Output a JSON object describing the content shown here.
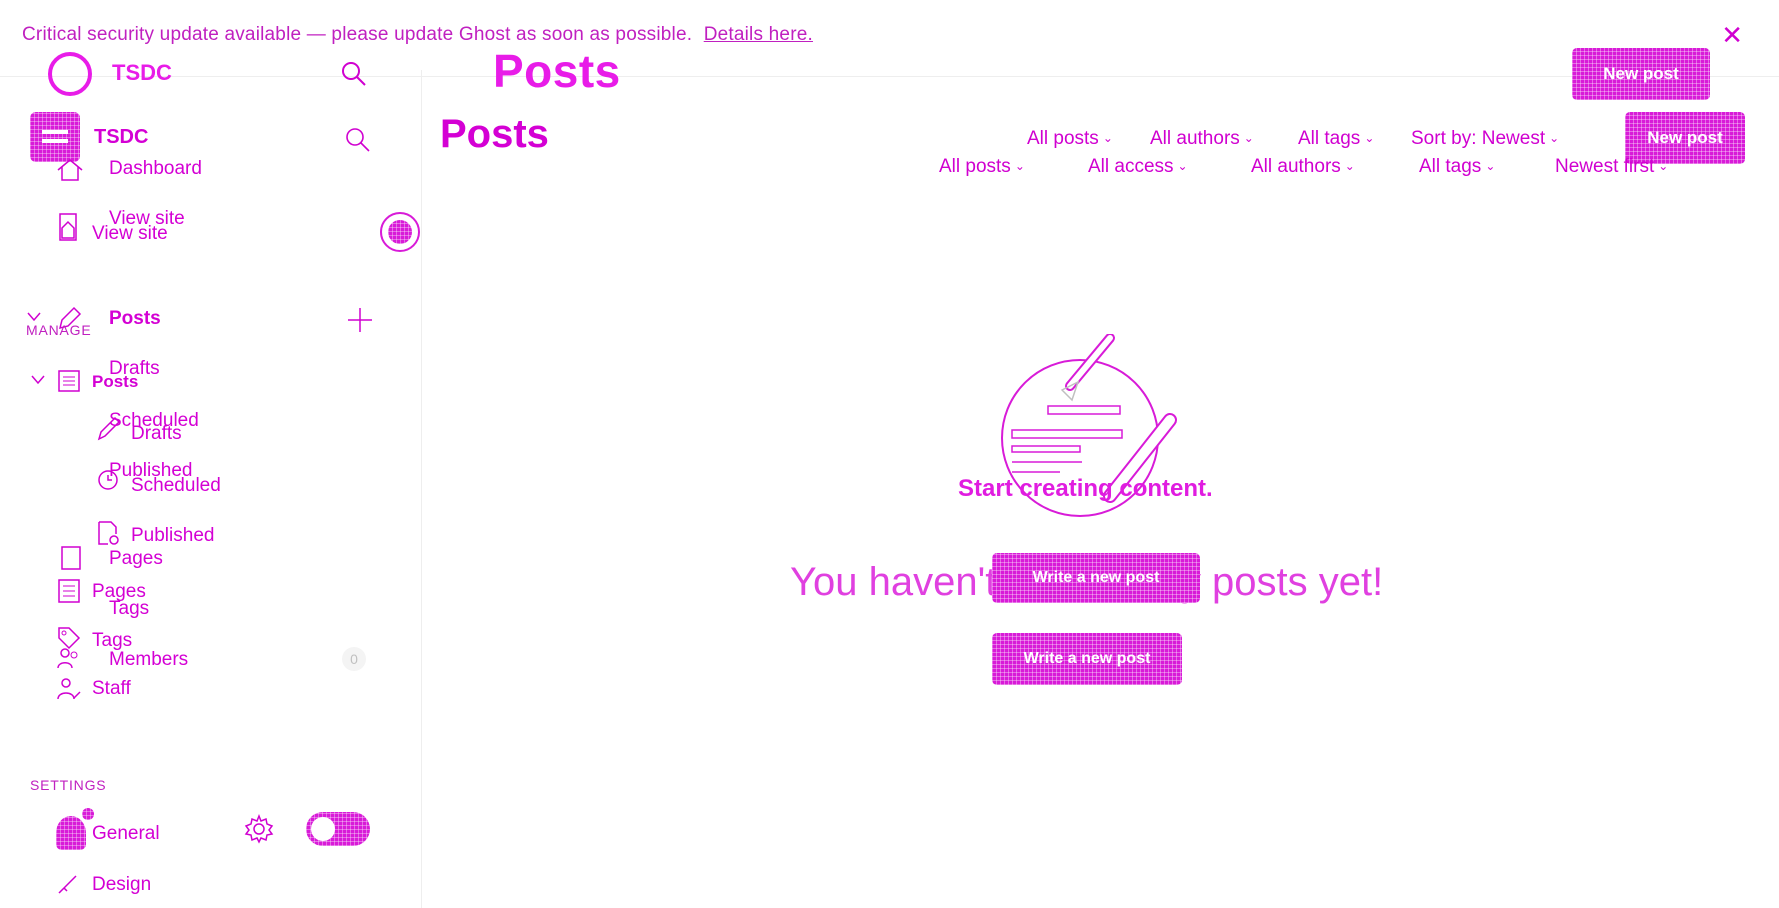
{
  "banner": {
    "text": "Critical security update available — please update Ghost as soon as possible.",
    "link": "Details here.",
    "close_icon": "close-icon"
  },
  "site": {
    "name_top": "TSDC",
    "name": "TSDC"
  },
  "header": {
    "title_top": "Posts",
    "title": "Posts",
    "new_post_top": "New post",
    "new_post": "New post"
  },
  "filters_row1": [
    "All posts",
    "All authors",
    "All tags",
    "Sort by: Newest"
  ],
  "filters_row2": [
    "All posts",
    "All access",
    "All authors",
    "All tags",
    "Newest first"
  ],
  "sidebar_top": {
    "dashboard": "Dashboard",
    "view_site": "View site",
    "posts": "Posts",
    "drafts": "Drafts",
    "scheduled": "Scheduled",
    "published": "Published",
    "pages": "Pages",
    "tags": "Tags",
    "members": "Members",
    "members_count": "0"
  },
  "sidebar": {
    "view_site": "View site",
    "manage_title": "MANAGE",
    "posts": "Posts",
    "drafts": "Drafts",
    "scheduled": "Scheduled",
    "published": "Published",
    "pages": "Pages",
    "tags": "Tags",
    "staff": "Staff",
    "settings_title": "SETTINGS",
    "general": "General",
    "design": "Design"
  },
  "empty_state": {
    "heading": "Start creating content.",
    "message": "You haven't written any posts yet!",
    "button_overlap": "Write a new post",
    "button": "Write a new post"
  },
  "colors": {
    "accent": "#d81bd8",
    "text": "#d400d4"
  }
}
